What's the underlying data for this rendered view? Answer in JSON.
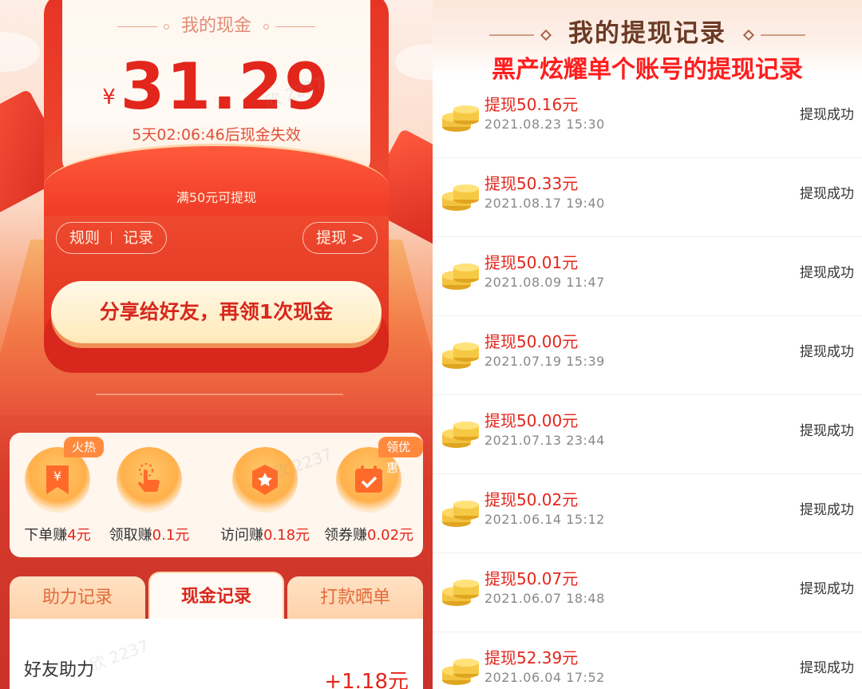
{
  "left": {
    "card_title": "我的现金",
    "currency_symbol": "¥",
    "amount": "31.29",
    "countdown": "5天02:06:46后现金失效",
    "threshold": "满50元可提现",
    "rules_label": "规则",
    "records_label": "记录",
    "withdraw_label": "提现 >",
    "share_button": "分享给好友，再领1次现金",
    "tasks": [
      {
        "name": "下单赚",
        "reward": "4元",
        "badge": "火热"
      },
      {
        "name": "领取赚",
        "reward": "0.1元",
        "badge": ""
      },
      {
        "name": "访问赚",
        "reward": "0.18元",
        "badge": ""
      },
      {
        "name": "领券赚",
        "reward": "0.02元",
        "badge": "领优惠"
      }
    ],
    "tabs": [
      "助力记录",
      "现金记录",
      "打款晒单"
    ],
    "active_tab": "现金记录",
    "list_item": {
      "name": "好友助力",
      "amount": "+1.18元"
    },
    "watermark": "欣 2237"
  },
  "right": {
    "title": "我的提现记录",
    "annotation": "黑产炫耀单个账号的提现记录",
    "records": [
      {
        "amount": "提现50.16元",
        "time": "2021.08.23 15:30",
        "status": "提现成功"
      },
      {
        "amount": "提现50.33元",
        "time": "2021.08.17 19:40",
        "status": "提现成功"
      },
      {
        "amount": "提现50.01元",
        "time": "2021.08.09 11:47",
        "status": "提现成功"
      },
      {
        "amount": "提现50.00元",
        "time": "2021.07.19 15:39",
        "status": "提现成功"
      },
      {
        "amount": "提现50.00元",
        "time": "2021.07.13 23:44",
        "status": "提现成功"
      },
      {
        "amount": "提现50.02元",
        "time": "2021.06.14 15:12",
        "status": "提现成功"
      },
      {
        "amount": "提现50.07元",
        "time": "2021.06.07 18:48",
        "status": "提现成功"
      },
      {
        "amount": "提现52.39元",
        "time": "2021.06.04 17:52",
        "status": "提现成功"
      }
    ]
  },
  "colors": {
    "accent_red": "#e3261b",
    "annotation_red": "#ff1e1e",
    "badge_orange": "#ff8a3d"
  }
}
